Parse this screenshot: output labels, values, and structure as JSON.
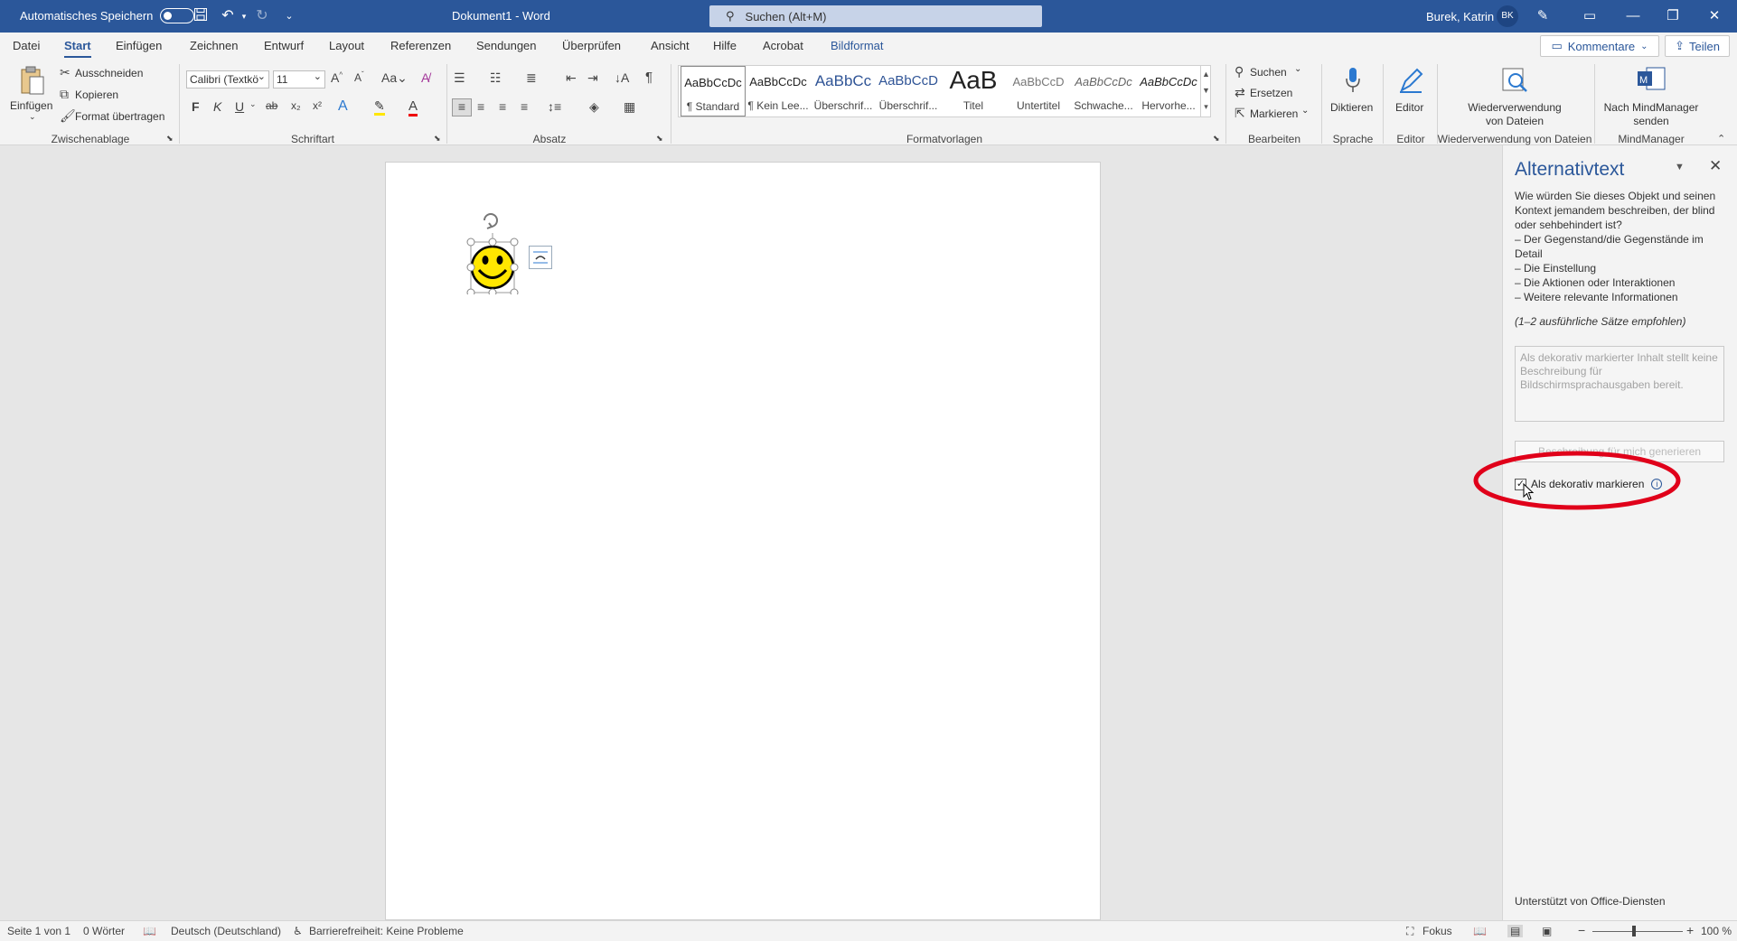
{
  "titlebar": {
    "autosave_label": "Automatisches Speichern",
    "doc_title": "Dokument1  -  Word",
    "search_placeholder": "Suchen (Alt+M)",
    "user_name": "Burek, Katrin",
    "user_initials": "BK"
  },
  "menu": {
    "items": [
      "Datei",
      "Start",
      "Einfügen",
      "Zeichnen",
      "Entwurf",
      "Layout",
      "Referenzen",
      "Sendungen",
      "Überprüfen",
      "Ansicht",
      "Hilfe",
      "Acrobat",
      "Bildformat"
    ],
    "active": "Start",
    "kommentare_label": "Kommentare",
    "teilen_label": "Teilen"
  },
  "ribbon": {
    "clipboard": {
      "paste_label": "Einfügen",
      "cut_label": "Ausschneiden",
      "copy_label": "Kopieren",
      "format_painter_label": "Format übertragen",
      "group_label": "Zwischenablage"
    },
    "font": {
      "font_name": "Calibri (Textkö",
      "font_size": "11",
      "bold": "F",
      "italic": "K",
      "underline": "U",
      "strike": "ab",
      "group_label": "Schriftart"
    },
    "paragraph": {
      "group_label": "Absatz"
    },
    "styles": {
      "items": [
        {
          "sample": "AaBbCcDc",
          "name": "¶ Standard"
        },
        {
          "sample": "AaBbCcDc",
          "name": "¶ Kein Lee..."
        },
        {
          "sample": "AaBbCc",
          "name": "Überschrif..."
        },
        {
          "sample": "AaBbCcD",
          "name": "Überschrif..."
        },
        {
          "sample": "AaB",
          "name": "Titel"
        },
        {
          "sample": "AaBbCcD",
          "name": "Untertitel"
        },
        {
          "sample": "AaBbCcDc",
          "name": "Schwache..."
        },
        {
          "sample": "AaBbCcDc",
          "name": "Hervorhe..."
        }
      ],
      "group_label": "Formatvorlagen"
    },
    "editing": {
      "find_label": "Suchen",
      "replace_label": "Ersetzen",
      "select_label": "Markieren",
      "group_label": "Bearbeiten"
    },
    "voice": {
      "dictate_label": "Diktieren",
      "group_label": "Sprache"
    },
    "editor": {
      "editor_label": "Editor",
      "group_label": "Editor"
    },
    "reuse": {
      "label_line1": "Wiederverwendung",
      "label_line2": "von Dateien",
      "group_label": "Wiederverwendung von Dateien"
    },
    "mindmanager": {
      "label_line1": "Nach MindManager",
      "label_line2": "senden",
      "group_label": "MindManager"
    }
  },
  "pane": {
    "title": "Alternativtext",
    "intro_lines": [
      "Wie würden Sie dieses Objekt und seinen Kontext jemandem beschreiben, der blind oder sehbehindert ist?",
      "– Der Gegenstand/die Gegenstände im Detail",
      "– Die Einstellung",
      "– Die Aktionen oder Interaktionen",
      "– Weitere relevante Informationen"
    ],
    "hint": "(1–2 ausführliche Sätze empfohlen)",
    "textarea_placeholder": "Als dekorativ markierter Inhalt stellt keine Beschreibung für Bildschirmsprachausgaben bereit.",
    "generate_label": "Beschreibung für mich generieren",
    "checkbox_label": "Als dekorativ markieren",
    "checkbox_checked": true,
    "footer": "Unterstützt von Office-Diensten"
  },
  "statusbar": {
    "page": "Seite 1 von 1",
    "words": "0 Wörter",
    "language": "Deutsch (Deutschland)",
    "accessibility": "Barrierefreiheit: Keine Probleme",
    "focus": "Fokus",
    "zoom": "100 %"
  }
}
